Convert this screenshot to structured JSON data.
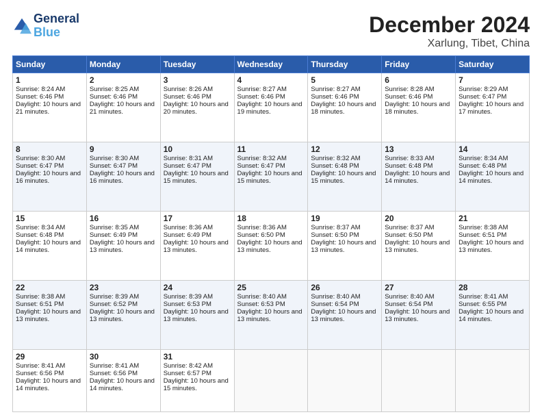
{
  "header": {
    "logo_line1": "General",
    "logo_line2": "Blue",
    "month_title": "December 2024",
    "location": "Xarlung, Tibet, China"
  },
  "days_of_week": [
    "Sunday",
    "Monday",
    "Tuesday",
    "Wednesday",
    "Thursday",
    "Friday",
    "Saturday"
  ],
  "weeks": [
    [
      {
        "day": "1",
        "sunrise": "8:24 AM",
        "sunset": "6:46 PM",
        "daylight": "10 hours and 21 minutes."
      },
      {
        "day": "2",
        "sunrise": "8:25 AM",
        "sunset": "6:46 PM",
        "daylight": "10 hours and 21 minutes."
      },
      {
        "day": "3",
        "sunrise": "8:26 AM",
        "sunset": "6:46 PM",
        "daylight": "10 hours and 20 minutes."
      },
      {
        "day": "4",
        "sunrise": "8:27 AM",
        "sunset": "6:46 PM",
        "daylight": "10 hours and 19 minutes."
      },
      {
        "day": "5",
        "sunrise": "8:27 AM",
        "sunset": "6:46 PM",
        "daylight": "10 hours and 18 minutes."
      },
      {
        "day": "6",
        "sunrise": "8:28 AM",
        "sunset": "6:46 PM",
        "daylight": "10 hours and 18 minutes."
      },
      {
        "day": "7",
        "sunrise": "8:29 AM",
        "sunset": "6:47 PM",
        "daylight": "10 hours and 17 minutes."
      }
    ],
    [
      {
        "day": "8",
        "sunrise": "8:30 AM",
        "sunset": "6:47 PM",
        "daylight": "10 hours and 16 minutes."
      },
      {
        "day": "9",
        "sunrise": "8:30 AM",
        "sunset": "6:47 PM",
        "daylight": "10 hours and 16 minutes."
      },
      {
        "day": "10",
        "sunrise": "8:31 AM",
        "sunset": "6:47 PM",
        "daylight": "10 hours and 15 minutes."
      },
      {
        "day": "11",
        "sunrise": "8:32 AM",
        "sunset": "6:47 PM",
        "daylight": "10 hours and 15 minutes."
      },
      {
        "day": "12",
        "sunrise": "8:32 AM",
        "sunset": "6:48 PM",
        "daylight": "10 hours and 15 minutes."
      },
      {
        "day": "13",
        "sunrise": "8:33 AM",
        "sunset": "6:48 PM",
        "daylight": "10 hours and 14 minutes."
      },
      {
        "day": "14",
        "sunrise": "8:34 AM",
        "sunset": "6:48 PM",
        "daylight": "10 hours and 14 minutes."
      }
    ],
    [
      {
        "day": "15",
        "sunrise": "8:34 AM",
        "sunset": "6:48 PM",
        "daylight": "10 hours and 14 minutes."
      },
      {
        "day": "16",
        "sunrise": "8:35 AM",
        "sunset": "6:49 PM",
        "daylight": "10 hours and 13 minutes."
      },
      {
        "day": "17",
        "sunrise": "8:36 AM",
        "sunset": "6:49 PM",
        "daylight": "10 hours and 13 minutes."
      },
      {
        "day": "18",
        "sunrise": "8:36 AM",
        "sunset": "6:50 PM",
        "daylight": "10 hours and 13 minutes."
      },
      {
        "day": "19",
        "sunrise": "8:37 AM",
        "sunset": "6:50 PM",
        "daylight": "10 hours and 13 minutes."
      },
      {
        "day": "20",
        "sunrise": "8:37 AM",
        "sunset": "6:50 PM",
        "daylight": "10 hours and 13 minutes."
      },
      {
        "day": "21",
        "sunrise": "8:38 AM",
        "sunset": "6:51 PM",
        "daylight": "10 hours and 13 minutes."
      }
    ],
    [
      {
        "day": "22",
        "sunrise": "8:38 AM",
        "sunset": "6:51 PM",
        "daylight": "10 hours and 13 minutes."
      },
      {
        "day": "23",
        "sunrise": "8:39 AM",
        "sunset": "6:52 PM",
        "daylight": "10 hours and 13 minutes."
      },
      {
        "day": "24",
        "sunrise": "8:39 AM",
        "sunset": "6:53 PM",
        "daylight": "10 hours and 13 minutes."
      },
      {
        "day": "25",
        "sunrise": "8:40 AM",
        "sunset": "6:53 PM",
        "daylight": "10 hours and 13 minutes."
      },
      {
        "day": "26",
        "sunrise": "8:40 AM",
        "sunset": "6:54 PM",
        "daylight": "10 hours and 13 minutes."
      },
      {
        "day": "27",
        "sunrise": "8:40 AM",
        "sunset": "6:54 PM",
        "daylight": "10 hours and 13 minutes."
      },
      {
        "day": "28",
        "sunrise": "8:41 AM",
        "sunset": "6:55 PM",
        "daylight": "10 hours and 14 minutes."
      }
    ],
    [
      {
        "day": "29",
        "sunrise": "8:41 AM",
        "sunset": "6:56 PM",
        "daylight": "10 hours and 14 minutes."
      },
      {
        "day": "30",
        "sunrise": "8:41 AM",
        "sunset": "6:56 PM",
        "daylight": "10 hours and 14 minutes."
      },
      {
        "day": "31",
        "sunrise": "8:42 AM",
        "sunset": "6:57 PM",
        "daylight": "10 hours and 15 minutes."
      },
      null,
      null,
      null,
      null
    ]
  ]
}
